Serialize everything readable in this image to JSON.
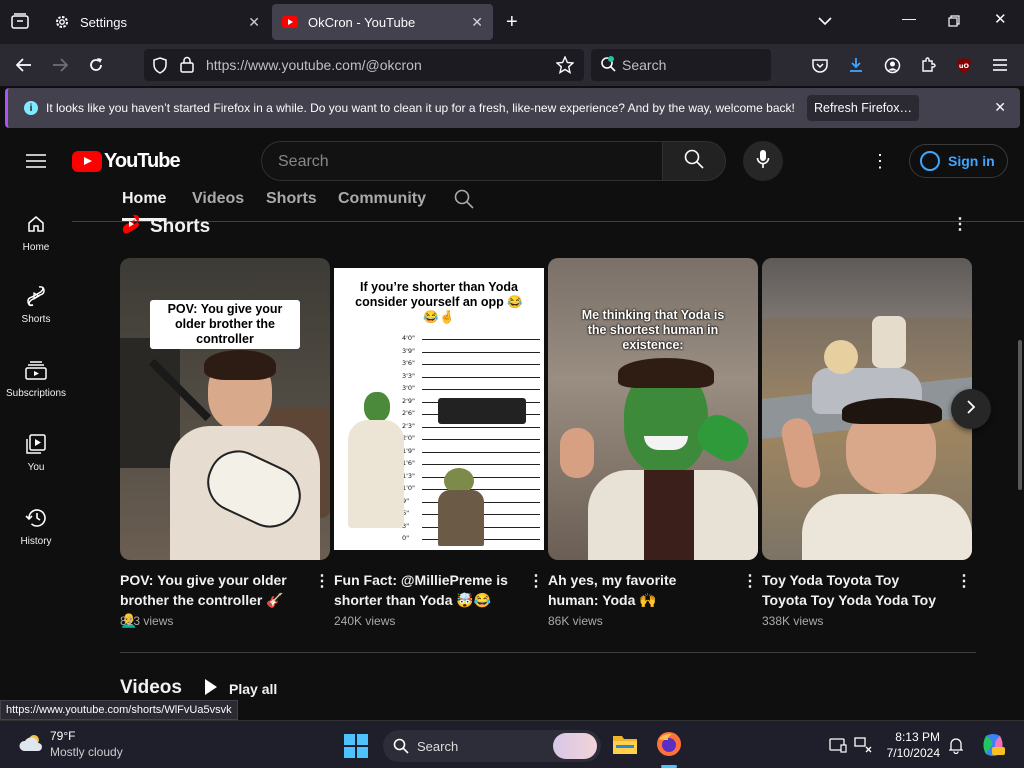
{
  "browser": {
    "tabs": [
      {
        "label": "Settings",
        "icon": "gear-icon"
      },
      {
        "label": "OkCron - YouTube",
        "icon": "youtube-icon",
        "active": true
      }
    ],
    "url": "https://www.youtube.com/@okcron",
    "search_placeholder": "Search",
    "notification": {
      "message": "It looks like you haven’t started Firefox in a while. Do you want to clean it up for a fresh, like-new experience? And by the way, welcome back!",
      "button": "Refresh Firefox…"
    },
    "status_url": "https://www.youtube.com/shorts/WlFvUa5vsvk"
  },
  "youtube": {
    "logo_text": "YouTube",
    "search_placeholder": "Search",
    "signin_label": "Sign in",
    "sidebar": [
      {
        "label": "Home",
        "icon": "home-icon"
      },
      {
        "label": "Shorts",
        "icon": "shorts-icon"
      },
      {
        "label": "Subscriptions",
        "icon": "subscriptions-icon"
      },
      {
        "label": "You",
        "icon": "you-icon"
      },
      {
        "label": "History",
        "icon": "history-icon"
      }
    ],
    "channel_tabs": [
      "Home",
      "Videos",
      "Shorts",
      "Community"
    ],
    "active_tab": "Home",
    "shorts_heading": "Shorts",
    "shorts": [
      {
        "title": "POV: You give your older brother the controller 🎸👨‍🦲",
        "views": "813 views",
        "overlay": "POV: You give your older brother the controller"
      },
      {
        "title": "Fun Fact: @MilliePreme is shorter than Yoda 🤯😂",
        "views": "240K views",
        "overlay": "If you’re shorter than Yoda consider yourself an opp 😂😂🤞"
      },
      {
        "title": "Ah yes, my favorite human: Yoda 🙌",
        "views": "86K views",
        "overlay": "Me thinking that Yoda is the shortest human in existence:"
      },
      {
        "title": "Toy Yoda Toyota Toy Toyota Toy Yoda Yoda Toy",
        "views": "338K views",
        "overlay": ""
      }
    ],
    "height_labels": [
      "4'0\"",
      "3'9\"",
      "3'6\"",
      "3'3\"",
      "3'0\"",
      "2'9\"",
      "2'6\"",
      "2'3\"",
      "2'0\"",
      "1'9\"",
      "1'6\"",
      "1'3\"",
      "1'0\"",
      "9\"",
      "6\"",
      "3\"",
      "0\""
    ],
    "videos_heading": "Videos",
    "play_all": "Play all"
  },
  "taskbar": {
    "weather_temp": "79°F",
    "weather_desc": "Mostly cloudy",
    "search_label": "Search",
    "time": "8:13 PM",
    "date": "7/10/2024"
  }
}
